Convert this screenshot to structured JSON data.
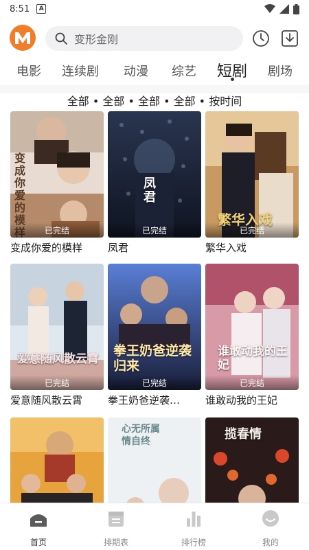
{
  "status_bar": {
    "time": "8:51",
    "app_badge": "A"
  },
  "search": {
    "placeholder": "变形金刚"
  },
  "tabs": [
    {
      "label": "电影"
    },
    {
      "label": "连续剧"
    },
    {
      "label": "动漫"
    },
    {
      "label": "综艺"
    },
    {
      "label": "短剧",
      "active": true
    },
    {
      "label": "剧场"
    }
  ],
  "filter": {
    "text": "全部 • 全部 • 全部 • 全部 • 按时间"
  },
  "cards": [
    {
      "title": "变成你爱的模样",
      "status": "已完结",
      "poster_text": "变成你爱的模样"
    },
    {
      "title": "凤君",
      "status": "已完结",
      "poster_text": "凤君"
    },
    {
      "title": "繁华入戏",
      "status": "已完结",
      "poster_text": "繁华入戏"
    },
    {
      "title": "爱意随风散云霄",
      "status": "已完结",
      "poster_text": "爱意随风散云霄"
    },
    {
      "title": "拳王奶爸逆袭…",
      "status": "已完结",
      "poster_text": "拳王奶爸逆袭归来"
    },
    {
      "title": "谁敢动我的王妃",
      "status": "已完结",
      "poster_text": "谁敢动我的王妃"
    },
    {
      "title": "",
      "status": "",
      "poster_text": ""
    },
    {
      "title": "",
      "status": "",
      "poster_text": "心无所属情自终"
    },
    {
      "title": "",
      "status": "",
      "poster_text": "揽春情"
    }
  ],
  "bottom_nav": [
    {
      "label": "首页",
      "icon": "home-icon",
      "active": true
    },
    {
      "label": "排期表",
      "icon": "calendar-icon"
    },
    {
      "label": "排行榜",
      "icon": "chart-icon"
    },
    {
      "label": "我的",
      "icon": "profile-icon"
    }
  ],
  "colors": {
    "brand": "#f07d2a",
    "tab_active": "#222222",
    "tab_inactive": "#555555"
  }
}
